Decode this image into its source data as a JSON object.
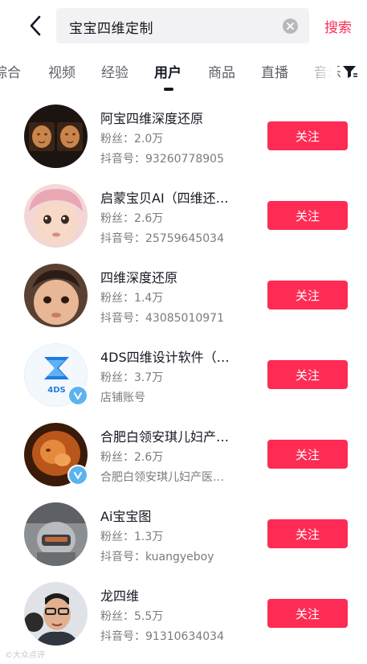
{
  "header": {
    "search_query": "宝宝四维定制",
    "search_button": "搜索"
  },
  "tabs": [
    {
      "label": "综合"
    },
    {
      "label": "视频"
    },
    {
      "label": "经验"
    },
    {
      "label": "用户"
    },
    {
      "label": "商品"
    },
    {
      "label": "直播"
    },
    {
      "label": "音乐"
    }
  ],
  "active_tab": "用户",
  "colors": {
    "accent": "#fe2c55",
    "text": "#161823",
    "secondary": "#7a7b80",
    "verify": "#5bb4f0"
  },
  "users": [
    {
      "name": "阿宝四维深度还原",
      "fans": "粉丝：2.0万",
      "sub": "抖音号：93260778905",
      "verified": false,
      "avatar": "3d-ultrasound-photo",
      "follow": "关注"
    },
    {
      "name": "启蒙宝贝AI（四维还…",
      "fans": "粉丝：2.6万",
      "sub": "抖音号：25759645034",
      "verified": false,
      "avatar": "baby-photo",
      "follow": "关注"
    },
    {
      "name": "四维深度还原",
      "fans": "粉丝：1.4万",
      "sub": "抖音号：43085010971",
      "verified": false,
      "avatar": "baby-photo",
      "follow": "关注"
    },
    {
      "name": "4DS四维设计软件（…",
      "fans": "粉丝：3.7万",
      "sub": "店铺账号",
      "verified": true,
      "avatar": "4ds-logo",
      "avatar_text": "4DS",
      "follow": "关注"
    },
    {
      "name": "合肥白领安琪儿妇产…",
      "fans": "粉丝：2.6万",
      "sub": "合肥白领安琪儿妇产医…",
      "verified": true,
      "avatar": "ultrasound-photo",
      "follow": "关注"
    },
    {
      "name": "Ai宝宝图",
      "fans": "粉丝：1.3万",
      "sub": "抖音号：kuangyeboy",
      "verified": false,
      "avatar": "robot-photo",
      "follow": "关注"
    },
    {
      "name": "龙四维",
      "fans": "粉丝：5.5万",
      "sub": "抖音号：91310634034",
      "verified": false,
      "avatar": "man-photo",
      "follow": "关注"
    }
  ],
  "watermark": "©大众点评"
}
